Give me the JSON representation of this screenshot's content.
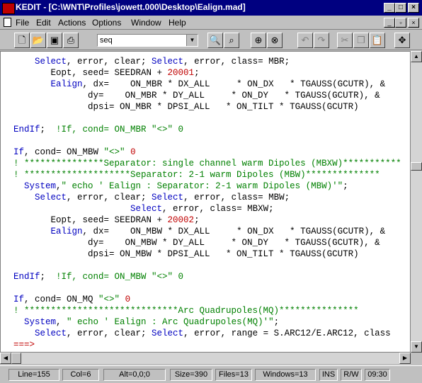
{
  "window": {
    "title": "KEDIT - [C:\\WNT\\Profiles\\jowett.000\\Desktop\\Ealign.mad]"
  },
  "menu": {
    "items": [
      {
        "id": "file",
        "label": "File"
      },
      {
        "id": "edit",
        "label": "Edit"
      },
      {
        "id": "actions",
        "label": "Actions"
      },
      {
        "id": "options",
        "label": "Options"
      },
      {
        "id": "window",
        "label": "Window"
      },
      {
        "id": "help",
        "label": "Help"
      }
    ]
  },
  "toolbar": {
    "search_value": "seq"
  },
  "editor": {
    "lines": [
      [
        [
          "kw",
          "    Select"
        ],
        [
          "id",
          ", error, clear; "
        ],
        [
          "kw",
          "Select"
        ],
        [
          "id",
          ", error, class= MBR;"
        ]
      ],
      [
        [
          "id",
          "       Eopt, seed= SEEDRAN + "
        ],
        [
          "num",
          "20001"
        ],
        [
          "id",
          ";"
        ]
      ],
      [
        [
          "kw",
          "       Ealign"
        ],
        [
          "id",
          ", dx=    ON_MBR * DX_ALL     * ON_DX   * TGAUSS(GCUTR), &"
        ]
      ],
      [
        [
          "id",
          "              dy=    ON_MBR * DY_ALL     * ON_DY   * TGAUSS(GCUTR), &"
        ]
      ],
      [
        [
          "id",
          "              dpsi= ON_MBR * DPSI_ALL   * ON_TILT * TGAUSS(GCUTR)"
        ]
      ],
      [
        [
          "id",
          ""
        ]
      ],
      [
        [
          "kw",
          "EndIf"
        ],
        [
          "id",
          ";  "
        ],
        [
          "str",
          "!If, cond= ON_MBR \"<>\" 0"
        ]
      ],
      [
        [
          "id",
          ""
        ]
      ],
      [
        [
          "kw",
          "If"
        ],
        [
          "id",
          ", cond= ON_MBW "
        ],
        [
          "str",
          "\"<>\""
        ],
        [
          "id",
          " "
        ],
        [
          "num",
          "0"
        ]
      ],
      [
        [
          "str",
          "! ***************Separator: single channel warm Dipoles (MBXW)***********"
        ]
      ],
      [
        [
          "str",
          "! ********************Separator: 2-1 warm Dipoles (MBW)**************"
        ]
      ],
      [
        [
          "kw",
          "  System"
        ],
        [
          "id",
          ","
        ],
        [
          "str",
          "\" echo ' Ealign : Separator: 2-1 warm Dipoles (MBW)'\""
        ],
        [
          "id",
          ";"
        ]
      ],
      [
        [
          "kw",
          "    Select"
        ],
        [
          "id",
          ", error, clear; "
        ],
        [
          "kw",
          "Select"
        ],
        [
          "id",
          ", error, class= MBW;"
        ]
      ],
      [
        [
          "id",
          "                      "
        ],
        [
          "kw",
          "Select"
        ],
        [
          "id",
          ", error, class= MBXW;"
        ]
      ],
      [
        [
          "id",
          "       Eopt, seed= SEEDRAN + "
        ],
        [
          "num",
          "20002"
        ],
        [
          "id",
          ";"
        ]
      ],
      [
        [
          "kw",
          "       Ealign"
        ],
        [
          "id",
          ", dx=    ON_MBW * DX_ALL     * ON_DX   * TGAUSS(GCUTR), &"
        ]
      ],
      [
        [
          "id",
          "              dy=    ON_MBW * DY_ALL     * ON_DY   * TGAUSS(GCUTR), &"
        ]
      ],
      [
        [
          "id",
          "              dpsi= ON_MBW * DPSI_ALL   * ON_TILT * TGAUSS(GCUTR)"
        ]
      ],
      [
        [
          "id",
          ""
        ]
      ],
      [
        [
          "kw",
          "EndIf"
        ],
        [
          "id",
          ";  "
        ],
        [
          "str",
          "!If, cond= ON_MBW \"<>\" 0"
        ]
      ],
      [
        [
          "id",
          ""
        ]
      ],
      [
        [
          "kw",
          "If"
        ],
        [
          "id",
          ", cond= ON_MQ "
        ],
        [
          "str",
          "\"<>\""
        ],
        [
          "id",
          " "
        ],
        [
          "num",
          "0"
        ]
      ],
      [
        [
          "str",
          "! *****************************Arc Quadrupoles(MQ)***************"
        ]
      ],
      [
        [
          "kw",
          "  System"
        ],
        [
          "id",
          ", "
        ],
        [
          "str",
          "\" echo ' Ealign : Arc Quadrupoles(MQ)'\""
        ],
        [
          "id",
          ";"
        ]
      ],
      [
        [
          "kw",
          "    Select"
        ],
        [
          "id",
          ", error, clear; "
        ],
        [
          "kw",
          "Select"
        ],
        [
          "id",
          ", error, range = S.ARC12/E.ARC12, class"
        ]
      ],
      [
        [
          "eof",
          "===>"
        ]
      ]
    ]
  },
  "status": {
    "line": "Line=155",
    "col": "Col=6",
    "alt": "Alt=0,0;0",
    "size": "Size=390",
    "files": "Files=13",
    "windows": "Windows=13",
    "ins": "INS",
    "rw": "R/W",
    "time": "09:30"
  },
  "colors": {
    "keyword": "#0000c0",
    "comment": "#008000",
    "number": "#c00000",
    "titlebar": "#000080"
  },
  "icons": [
    "app-icon",
    "new-file-icon",
    "open-folder-icon",
    "save-icon",
    "print-icon",
    "find-icon",
    "find-next-icon",
    "zoom-icon",
    "undo-icon",
    "redo-icon",
    "cut-icon",
    "copy-icon",
    "paste-icon",
    "settings-icon"
  ]
}
